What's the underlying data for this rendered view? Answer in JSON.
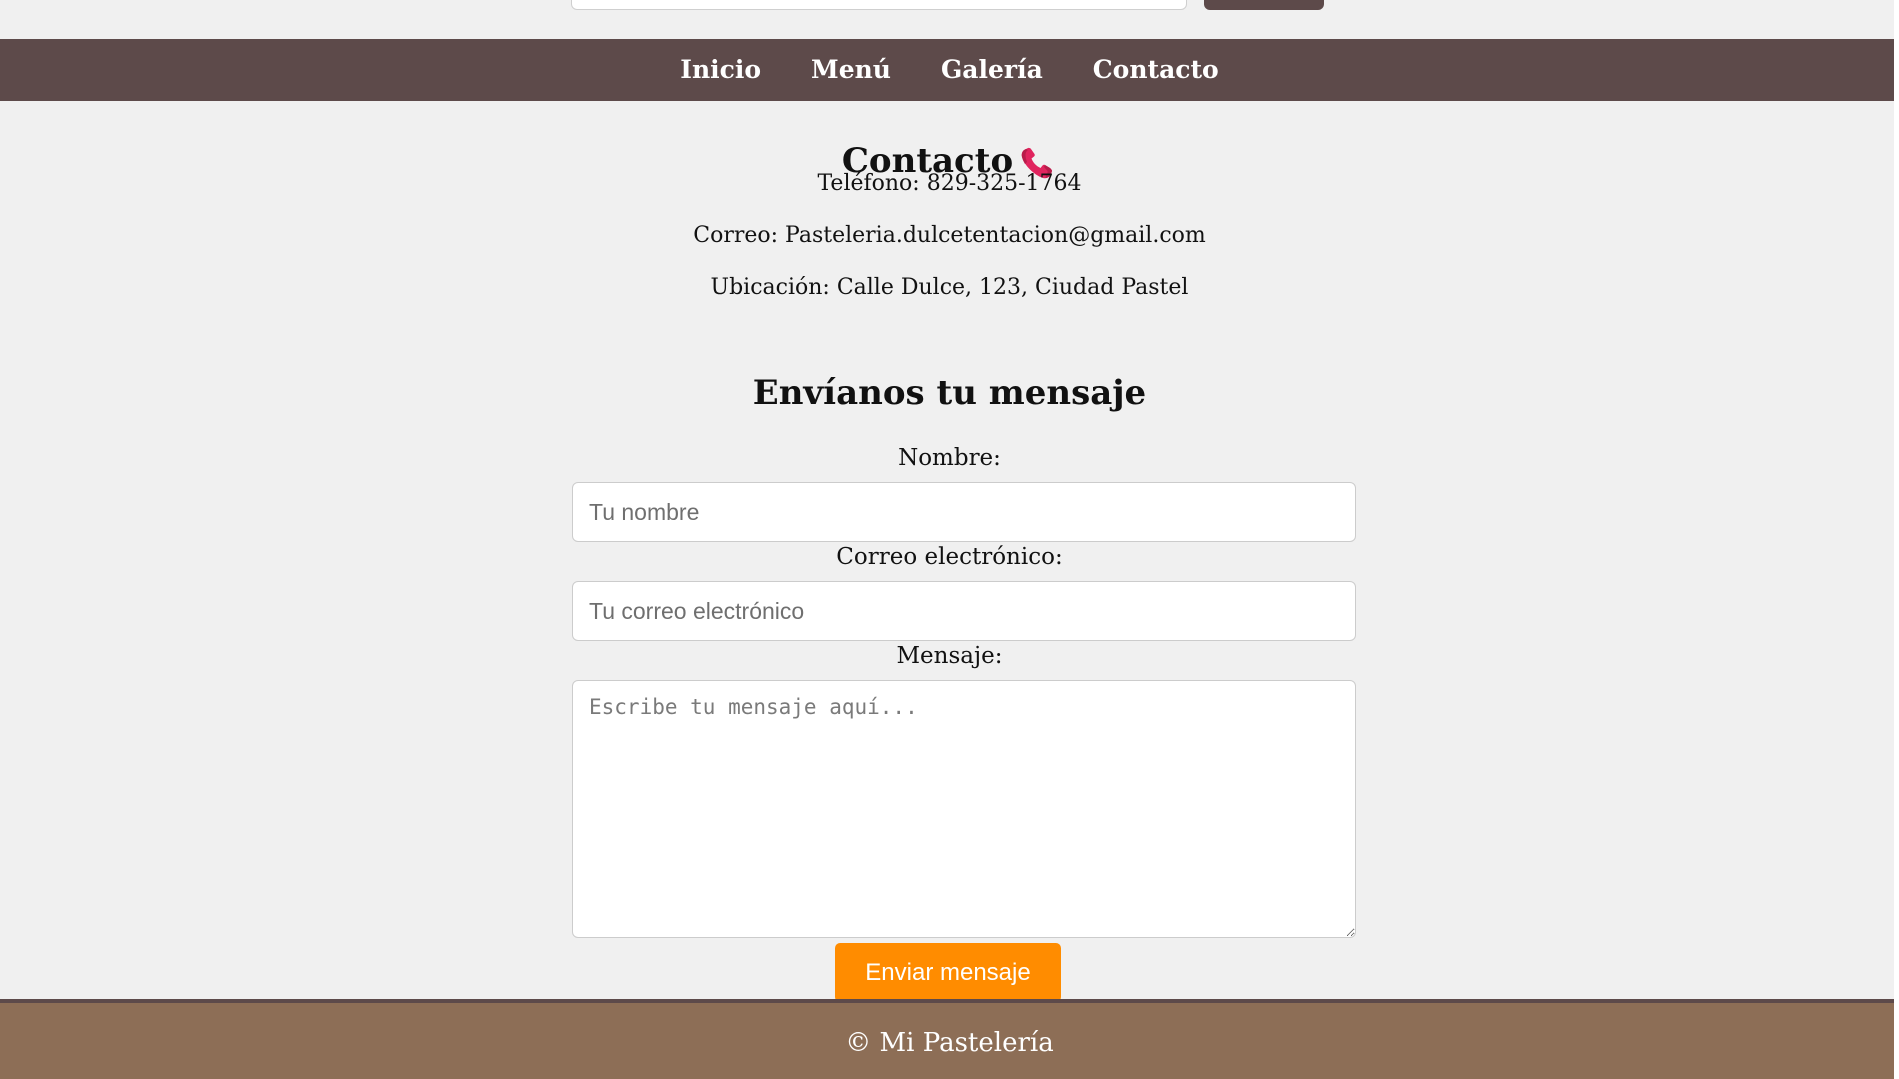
{
  "nav": {
    "items": [
      {
        "label": "Inicio"
      },
      {
        "label": "Menú"
      },
      {
        "label": "Galería"
      },
      {
        "label": "Contacto"
      }
    ]
  },
  "contact": {
    "title": "Contacto",
    "phone": "Teléfono: 829-325-1764",
    "email": "Correo: Pasteleria.dulcetentacion@gmail.com",
    "location": "Ubicación: Calle Dulce, 123, Ciudad Pastel"
  },
  "form": {
    "title": "Envíanos tu mensaje",
    "name_label": "Nombre:",
    "name_placeholder": "Tu nombre",
    "email_label": "Correo electrónico:",
    "email_placeholder": "Tu correo electrónico",
    "message_label": "Mensaje:",
    "message_placeholder": "Escribe tu mensaje aquí...",
    "submit_label": "Enviar mensaje"
  },
  "footer": {
    "text": "© Mi Pastelería"
  },
  "icons": {
    "phone": "phone-icon"
  },
  "colors": {
    "nav_bg": "#5d4a4a",
    "page_bg": "#f0f0f0",
    "button_accent": "#ff8c00",
    "footer_bg": "#8d6e56"
  }
}
